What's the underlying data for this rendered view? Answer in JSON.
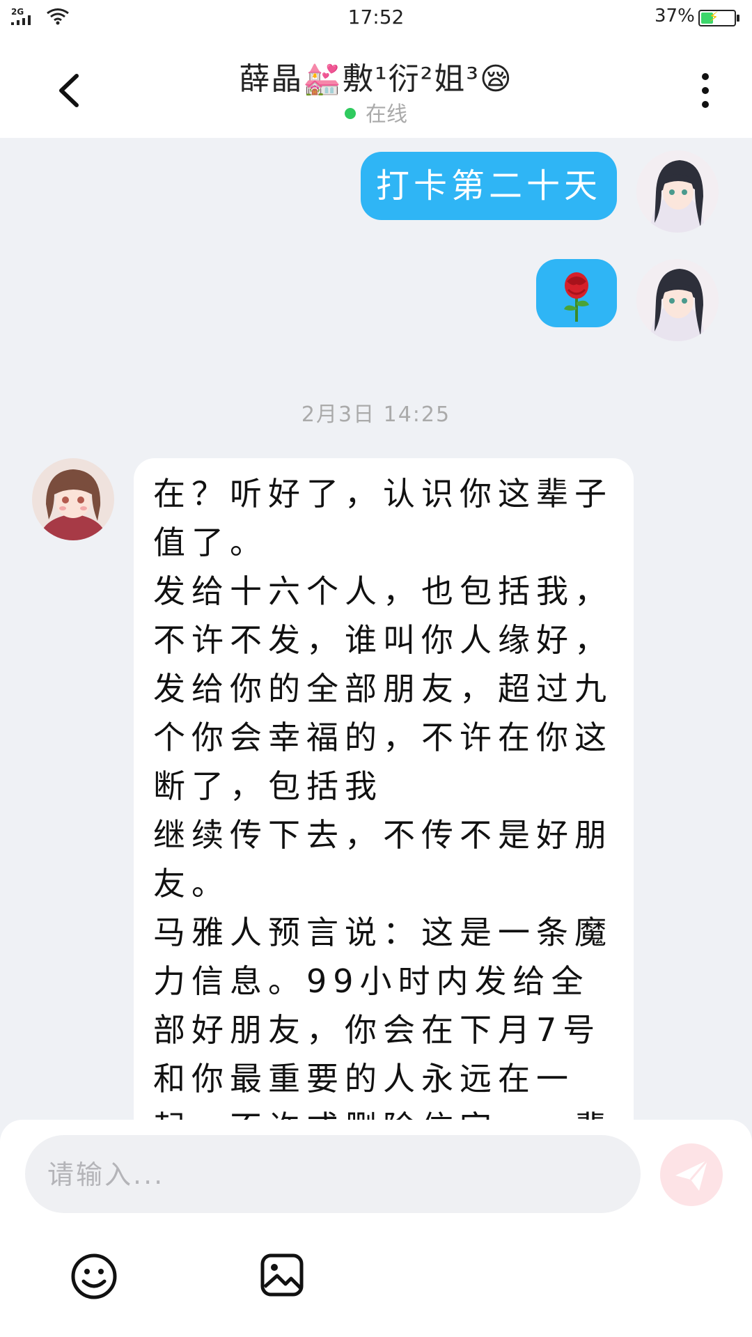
{
  "status_bar": {
    "network": "2G",
    "time": "17:52",
    "battery": "37%",
    "battery_level": 0.37,
    "battery_color": "#3cd66b"
  },
  "header": {
    "title": "薛晶💒敷¹衍²姐³😪",
    "status": "在线",
    "status_color": "#2fca5e",
    "back_icon": "chevron-left-icon",
    "more_icon": "vertical-dots-icon"
  },
  "messages": {
    "outgoing_1": "打卡第二十天",
    "outgoing_2_emoji": "🌹",
    "timestamp": "2月3日 14:25",
    "incoming_1": "在？听好了，认识你这辈子值了。\n发给十六个人，也包括我，不许不发，谁叫你人缘好，发给你的全部朋友，超过九个你会幸福的，不许在你这断了，包括我\n继续传下去，不传不是好朋友。\n马雅人预言说：这是一条魔力信息。99小时内发给全部好朋友，你会在下月7号和你最重要的人永远在一起，不许或删除信字，一辈子七七个"
  },
  "composer": {
    "placeholder": "请输入...",
    "emoji_icon": "smiley-icon",
    "image_icon": "image-icon",
    "send_icon": "paper-plane-icon"
  },
  "colors": {
    "accent": "#2fb5f5",
    "background": "#eff1f5",
    "send_button": "#fde3e6"
  }
}
